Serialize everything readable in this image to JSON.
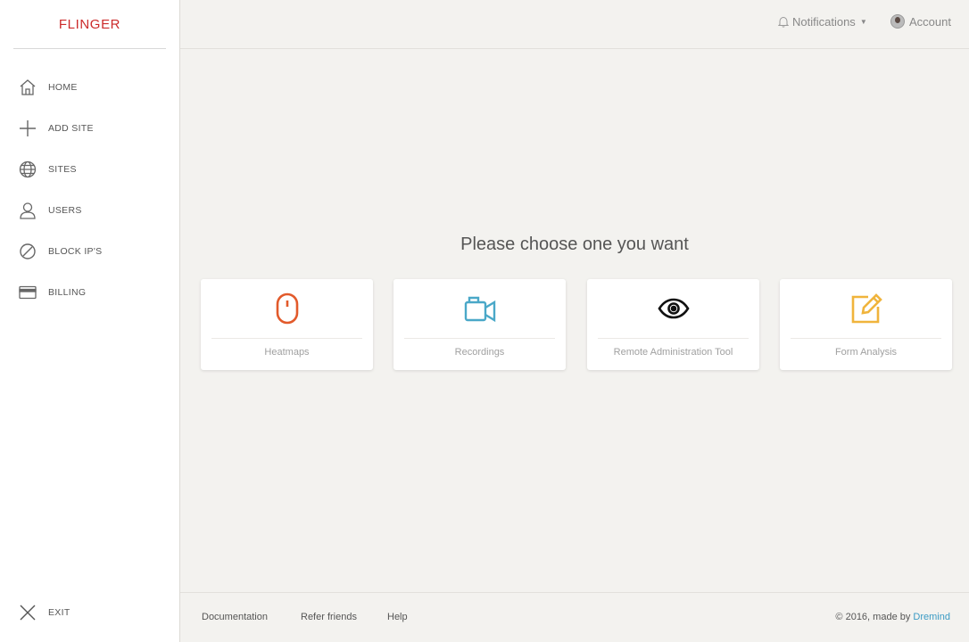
{
  "brand": {
    "name": "FLINGER",
    "color": "#cc2b2b"
  },
  "sidebar": {
    "items": [
      {
        "label": "HOME",
        "icon": "home-icon"
      },
      {
        "label": "ADD SITE",
        "icon": "plus-icon"
      },
      {
        "label": "SITES",
        "icon": "globe-icon"
      },
      {
        "label": "USERS",
        "icon": "user-icon"
      },
      {
        "label": "BLOCK IP'S",
        "icon": "block-icon"
      },
      {
        "label": "BILLING",
        "icon": "credit-card-icon"
      }
    ],
    "exit_label": "EXIT"
  },
  "topbar": {
    "notifications_label": "Notifications",
    "account_label": "Account"
  },
  "main": {
    "title": "Please choose one you want",
    "cards": [
      {
        "label": "Heatmaps",
        "icon": "mouse-icon",
        "color": "#e25a2b"
      },
      {
        "label": "Recordings",
        "icon": "video-camera-icon",
        "color": "#4aa8c8"
      },
      {
        "label": "Remote Administration Tool",
        "icon": "eye-icon",
        "color": "#111111"
      },
      {
        "label": "Form Analysis",
        "icon": "edit-icon",
        "color": "#f0b43c"
      }
    ]
  },
  "footer": {
    "links": [
      "Documentation",
      "Refer friends",
      "Help"
    ],
    "copyright_prefix": "© 2016, made by",
    "copyright_link": "Dremind",
    "link_color": "#3b9bc4"
  }
}
